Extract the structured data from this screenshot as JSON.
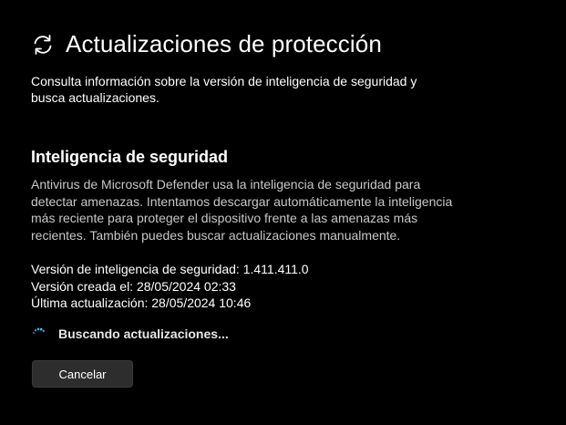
{
  "header": {
    "icon": "refresh-icon",
    "title": "Actualizaciones de protección"
  },
  "intro": "Consulta información sobre la versión de inteligencia de seguridad y busca actualizaciones.",
  "section": {
    "title": "Inteligencia de seguridad",
    "description": "Antivirus de Microsoft Defender usa la inteligencia de seguridad para detectar amenazas. Intentamos descargar automáticamente la inteligencia más reciente para proteger el dispositivo frente a las amenazas más recientes. También puedes buscar actualizaciones manualmente."
  },
  "info": {
    "version": "Versión de inteligencia de seguridad: 1.411.411.0",
    "created": "Versión creada el: 28/05/2024 02:33",
    "last_update": "Última actualización: 28/05/2024 10:46"
  },
  "status": {
    "icon": "loading-spinner-icon",
    "label": "Buscando actualizaciones..."
  },
  "actions": {
    "cancel_label": "Cancelar"
  },
  "colors": {
    "background": "#000000",
    "accent": "#4cc2ff",
    "button": "#2d2d2d"
  }
}
